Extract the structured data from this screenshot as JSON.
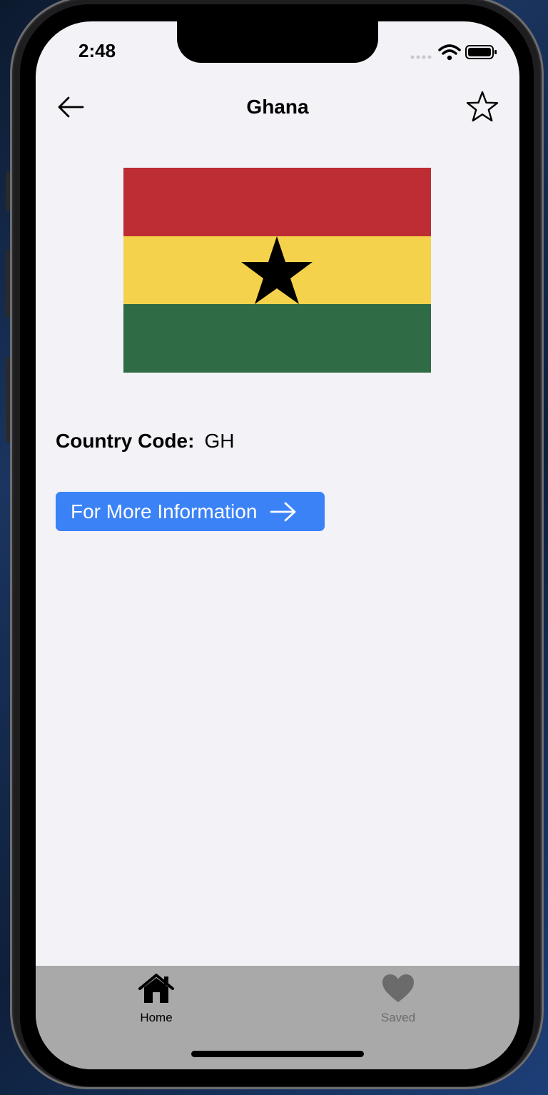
{
  "status_bar": {
    "time": "2:48",
    "icons": [
      "signal-dots-icon",
      "wifi-icon",
      "battery-icon"
    ]
  },
  "nav": {
    "title": "Ghana",
    "back_icon": "arrow-left-icon",
    "favorite_icon": "star-outline-icon"
  },
  "flag": {
    "country": "Ghana",
    "colors": [
      "#bd2d33",
      "#f5d24b",
      "#2f6b44"
    ],
    "star_color": "#000000"
  },
  "details": {
    "code_label": "Country Code:",
    "code_value": "GH"
  },
  "more_button": {
    "label": "For More Information",
    "icon": "arrow-right-icon",
    "color": "#3b82f6"
  },
  "tabbar": {
    "tabs": [
      {
        "label": "Home",
        "icon": "home-icon",
        "active": true
      },
      {
        "label": "Saved",
        "icon": "heart-icon",
        "active": false
      }
    ]
  }
}
